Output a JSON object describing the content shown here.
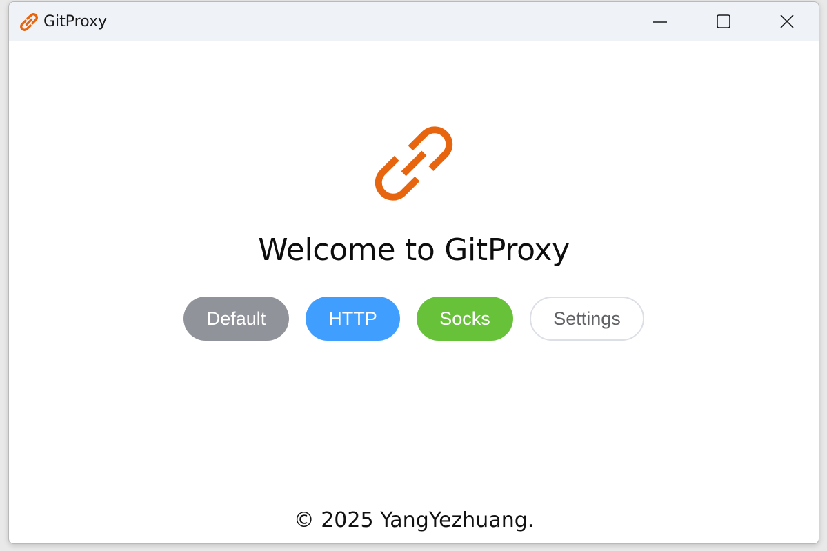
{
  "window": {
    "title": "GitProxy"
  },
  "icons": {
    "app": "chain-link-icon",
    "minimize": "minimize-icon",
    "maximize": "maximize-icon",
    "close": "close-icon"
  },
  "main": {
    "heading": "Welcome to GitProxy",
    "buttons": [
      {
        "label": "Default"
      },
      {
        "label": "HTTP"
      },
      {
        "label": "Socks"
      },
      {
        "label": "Settings"
      }
    ],
    "footer": "© 2025 YangYezhuang."
  },
  "colors": {
    "accent": "#e8650f",
    "default": "#909399",
    "http": "#409eff",
    "socks": "#67c23a",
    "titlebar": "#eff3f8"
  }
}
